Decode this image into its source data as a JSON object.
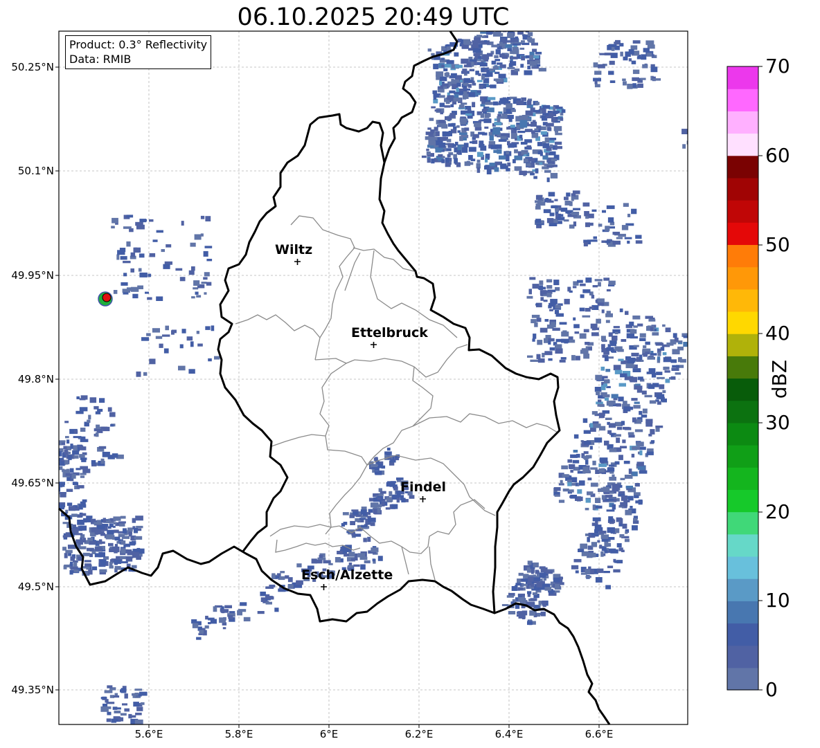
{
  "title": "06.10.2025 20:49 UTC",
  "info": {
    "product": "Product: 0.3° Reflectivity",
    "data": "Data: RMIB"
  },
  "lat_ticks": [
    "50.25°N",
    "50.1°N",
    "49.95°N",
    "49.8°N",
    "49.65°N",
    "49.5°N",
    "49.35°N"
  ],
  "lon_ticks": [
    "5.6°E",
    "5.8°E",
    "6°E",
    "6.2°E",
    "6.4°E",
    "6.6°E"
  ],
  "cities": [
    {
      "name": "Wiltz"
    },
    {
      "name": "Ettelbruck"
    },
    {
      "name": "Findel"
    },
    {
      "name": "Esch/Alzette"
    }
  ],
  "colorbar": {
    "label": "dBZ",
    "ticks": [
      "0",
      "10",
      "20",
      "30",
      "40",
      "50",
      "60",
      "70"
    ],
    "colors": [
      "#6175a8",
      "#5062a3",
      "#425da6",
      "#4877b0",
      "#5a9ac6",
      "#68c0dc",
      "#66d8c8",
      "#40d878",
      "#16c92a",
      "#14b51e",
      "#109f17",
      "#0c8a12",
      "#0c7210",
      "#085c0a",
      "#487a0a",
      "#b0b20a",
      "#ffd800",
      "#ffb808",
      "#ff9808",
      "#ff7c08",
      "#e40808",
      "#c00606",
      "#a00404",
      "#7a0202",
      "#ffe0ff",
      "#ffb0ff",
      "#ff68ff",
      "#ec38ec"
    ]
  },
  "radar_site_colors": {
    "ring": "#1fae3b",
    "center": "#e01010"
  }
}
